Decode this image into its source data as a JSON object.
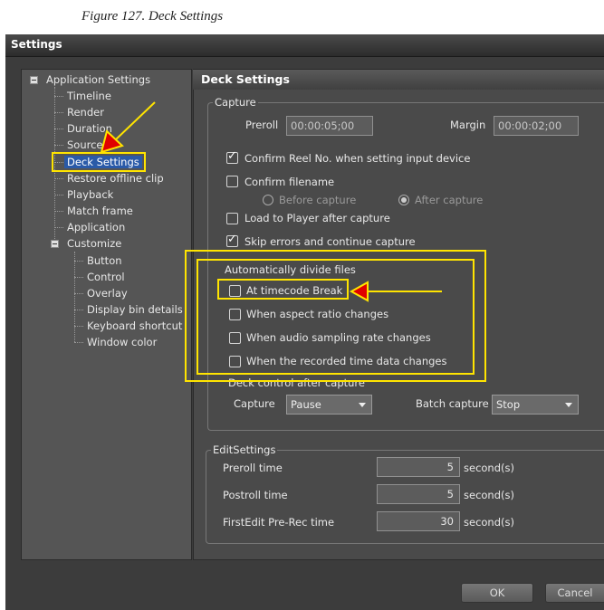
{
  "caption": "Figure 127.  Deck Settings",
  "window": {
    "title": "Settings"
  },
  "tree": {
    "app_settings": "Application Settings",
    "items": [
      "Timeline",
      "Render",
      "Duration",
      "Source",
      "Deck Settings",
      "Restore offline clip",
      "Playback",
      "Match frame",
      "Application"
    ],
    "customize": "Customize",
    "customize_items": [
      "Button",
      "Control",
      "Overlay",
      "Display bin details",
      "Keyboard shortcut",
      "Window color"
    ]
  },
  "panel": {
    "title": "Deck Settings",
    "capture": {
      "legend": "Capture",
      "preroll_label": "Preroll",
      "preroll_value": "00:00:05;00",
      "margin_label": "Margin",
      "margin_value": "00:00:02;00",
      "confirm_reel": "Confirm Reel No. when setting input device",
      "confirm_filename": "Confirm filename",
      "before_capture": "Before capture",
      "after_capture": "After capture",
      "load_player": "Load to Player after capture",
      "skip_errors": "Skip errors and continue capture",
      "auto_divide": "Automatically divide files",
      "at_timecode": "At timecode Break",
      "aspect_changes": "When aspect ratio changes",
      "audio_changes": "When audio sampling rate changes",
      "recorded_changes": "When the recorded time data changes",
      "deck_control": "Deck control after capture",
      "capture_label": "Capture",
      "capture_value": "Pause",
      "batch_label": "Batch capture",
      "batch_value": "Stop"
    },
    "edit": {
      "legend": "EditSettings",
      "preroll_time": "Preroll time",
      "preroll_value": "5",
      "postroll_time": "Postroll time",
      "postroll_value": "5",
      "firstedit": "FirstEdit Pre-Rec time",
      "firstedit_value": "30",
      "unit": "second(s)"
    }
  },
  "buttons": {
    "ok": "OK",
    "cancel": "Cancel"
  },
  "colors": {
    "highlight": "#ffe400",
    "selection": "#2a5aa8",
    "arrow_fill": "#e00000"
  }
}
